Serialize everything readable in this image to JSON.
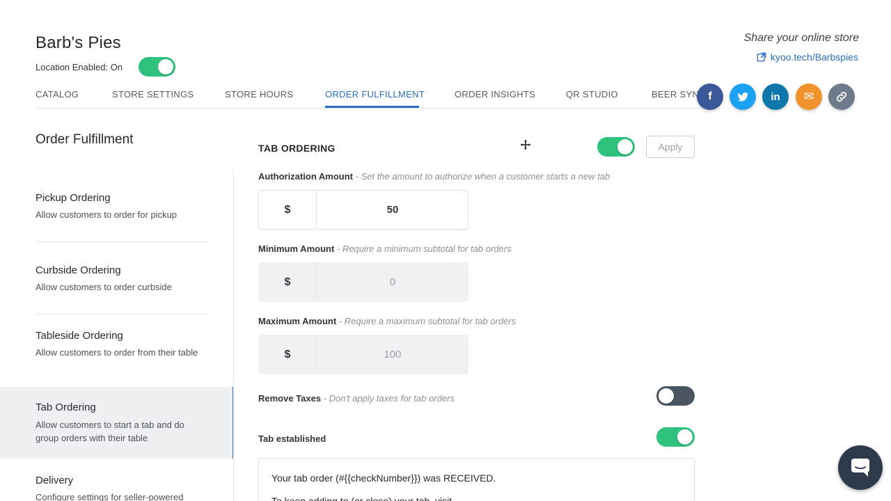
{
  "store": {
    "name": "Barb's Pies",
    "location_label": "Location Enabled: On",
    "location_enabled": true
  },
  "share": {
    "title": "Share your online store",
    "link_text": "kyoo.tech/Barbspies",
    "social": [
      {
        "name": "facebook",
        "glyph": "f",
        "color": "#3b5998"
      },
      {
        "name": "twitter",
        "glyph": "t",
        "color": "#1da1f2"
      },
      {
        "name": "linkedin",
        "glyph": "in",
        "color": "#0e76a8"
      },
      {
        "name": "email",
        "glyph": "✉",
        "color": "#f0932b"
      },
      {
        "name": "copy-link",
        "glyph": "⛓",
        "color": "#6e7b8a"
      }
    ]
  },
  "tabs": [
    {
      "label": "CATALOG"
    },
    {
      "label": "STORE SETTINGS"
    },
    {
      "label": "STORE HOURS"
    },
    {
      "label": "ORDER FULFILLMENT"
    },
    {
      "label": "ORDER INSIGHTS"
    },
    {
      "label": "QR STUDIO"
    },
    {
      "label": "BEER SYNC"
    }
  ],
  "active_tab": "ORDER FULFILLMENT",
  "sidebar": {
    "heading": "Order Fulfillment",
    "items": [
      {
        "label": "Pickup Ordering",
        "desc": "Allow customers to order for pickup"
      },
      {
        "label": "Curbside Ordering",
        "desc": "Allow customers to order curbside"
      },
      {
        "label": "Tableside Ordering",
        "desc": "Allow customers to order from their table"
      },
      {
        "label": "Tab Ordering",
        "desc": "Allow customers to start a tab and do group orders with their table"
      },
      {
        "label": "Delivery",
        "desc": "Configure settings for seller-powered"
      }
    ],
    "active_item": "Tab Ordering"
  },
  "main": {
    "section_title": "TAB ORDERING",
    "section_enabled": true,
    "apply_label": "Apply",
    "auth": {
      "label": "Authorization Amount",
      "hint": "- Set the amount to authorize when a customer starts a new tab",
      "currency": "$",
      "value": "50"
    },
    "min": {
      "label": "Minimum Amount",
      "hint": "- Require a minimum subtotal for tab orders",
      "currency": "$",
      "value": "0"
    },
    "max": {
      "label": "Maximum Amount",
      "hint": "- Require a maximum subtotal for tab orders",
      "currency": "$",
      "value": "100"
    },
    "remove_taxes": {
      "label": "Remove Taxes",
      "hint": "- Don't apply taxes for tab orders",
      "enabled": false
    },
    "tab_established": {
      "label": "Tab established",
      "enabled": true
    },
    "message": {
      "line1": "Your tab order (#{{checkNumber}}) was RECEIVED.",
      "line2": "To keep adding to (or close) your tab, visit"
    }
  },
  "colors": {
    "accent": "#2a6fbf",
    "toggle_on": "#2ec27e",
    "toggle_off": "#4a5561"
  }
}
